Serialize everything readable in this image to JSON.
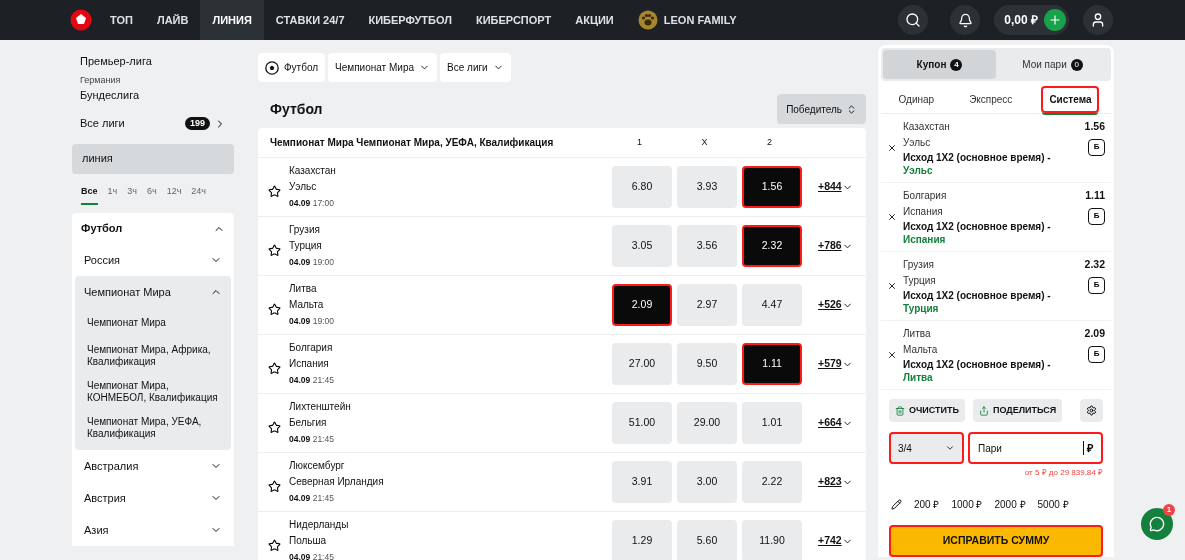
{
  "nav": {
    "items": [
      {
        "label": "ТОП",
        "selected": false
      },
      {
        "label": "ЛАЙВ",
        "selected": false
      },
      {
        "label": "ЛИНИЯ",
        "selected": true
      },
      {
        "label": "СТАВКИ 24/7",
        "selected": false
      },
      {
        "label": "КИБЕРФУТБОЛ",
        "selected": false
      },
      {
        "label": "КИБЕРСПОРТ",
        "selected": false
      },
      {
        "label": "АКЦИИ",
        "selected": false
      },
      {
        "label": "LEON FAMILY",
        "selected": false
      }
    ],
    "balance": "0,00 ₽"
  },
  "sidebar": {
    "top_leagues": [
      {
        "league": "Премьер-лига"
      },
      {
        "country": "Германия",
        "league": "Бундеслига"
      }
    ],
    "all_leagues": {
      "label": "Все лиги",
      "count": "199"
    },
    "section": "линия",
    "time_filters": [
      {
        "label": "Все",
        "selected": true
      },
      {
        "label": "1ч",
        "selected": false
      },
      {
        "label": "3ч",
        "selected": false
      },
      {
        "label": "6ч",
        "selected": false
      },
      {
        "label": "12ч",
        "selected": false
      },
      {
        "label": "24ч",
        "selected": false
      }
    ],
    "sport": {
      "label": "Футбол",
      "expanded": true,
      "children": [
        {
          "label": "Россия",
          "expanded": false
        },
        {
          "label": "Чемпионат Мира",
          "expanded": true,
          "children": [
            {
              "label": "Чемпионат Мира"
            },
            {
              "label": "Чемпионат Мира, Африка, Квалификация"
            },
            {
              "label": "Чемпионат Мира, КОНМЕБОЛ, Квалификация"
            },
            {
              "label": "Чемпионат Мира, УЕФА, Квалификация"
            }
          ]
        },
        {
          "label": "Австралия",
          "expanded": false
        },
        {
          "label": "Австрия",
          "expanded": false
        },
        {
          "label": "Азия",
          "expanded": false
        }
      ]
    }
  },
  "filters": [
    {
      "label": "Футбол",
      "kind": "sport"
    },
    {
      "label": "Чемпионат Мира",
      "kind": "dropdown"
    },
    {
      "label": "Все лиги",
      "kind": "dropdown"
    }
  ],
  "main": {
    "title": "Футбол",
    "sort": "Победитель",
    "league": "Чемпионат Мира Чемпионат Мира, УЕФА, Квалификация",
    "columns": [
      "1",
      "X",
      "2"
    ],
    "events": [
      {
        "home": "Казахстан",
        "away": "Уэльс",
        "date": "04.09",
        "time": "17:00",
        "more": "+844",
        "odds": [
          {
            "value": "6.80",
            "selected": false
          },
          {
            "value": "3.93",
            "selected": false
          },
          {
            "value": "1.56",
            "selected": true
          }
        ]
      },
      {
        "home": "Грузия",
        "away": "Турция",
        "date": "04.09",
        "time": "19:00",
        "more": "+786",
        "odds": [
          {
            "value": "3.05",
            "selected": false
          },
          {
            "value": "3.56",
            "selected": false
          },
          {
            "value": "2.32",
            "selected": true
          }
        ]
      },
      {
        "home": "Литва",
        "away": "Мальта",
        "date": "04.09",
        "time": "19:00",
        "more": "+526",
        "odds": [
          {
            "value": "2.09",
            "selected": true
          },
          {
            "value": "2.97",
            "selected": false
          },
          {
            "value": "4.47",
            "selected": false
          }
        ]
      },
      {
        "home": "Болгария",
        "away": "Испания",
        "date": "04.09",
        "time": "21:45",
        "more": "+579",
        "odds": [
          {
            "value": "27.00",
            "selected": false
          },
          {
            "value": "9.50",
            "selected": false
          },
          {
            "value": "1.11",
            "selected": true
          }
        ]
      },
      {
        "home": "Лихтенштейн",
        "away": "Бельгия",
        "date": "04.09",
        "time": "21:45",
        "more": "+664",
        "odds": [
          {
            "value": "51.00",
            "selected": false
          },
          {
            "value": "29.00",
            "selected": false
          },
          {
            "value": "1.01",
            "selected": false
          }
        ]
      },
      {
        "home": "Люксембург",
        "away": "Северная Ирландия",
        "date": "04.09",
        "time": "21:45",
        "more": "+823",
        "odds": [
          {
            "value": "3.91",
            "selected": false
          },
          {
            "value": "3.00",
            "selected": false
          },
          {
            "value": "2.22",
            "selected": false
          }
        ]
      },
      {
        "home": "Нидерланды",
        "away": "Польша",
        "date": "04.09",
        "time": "21:45",
        "more": "+742",
        "odds": [
          {
            "value": "1.29",
            "selected": false
          },
          {
            "value": "5.60",
            "selected": false
          },
          {
            "value": "11.90",
            "selected": false
          }
        ]
      }
    ]
  },
  "coupon": {
    "tabs": [
      {
        "label": "Купон",
        "count": "4",
        "selected": true
      },
      {
        "label": "Мои пари",
        "count": "0",
        "selected": false
      }
    ],
    "bet_types": [
      {
        "label": "Одинар",
        "selected": false
      },
      {
        "label": "Экспресс",
        "selected": false
      },
      {
        "label": "Система",
        "selected": true
      }
    ],
    "bets": [
      {
        "home": "Казахстан",
        "away": "Уэльс",
        "market": "Исход 1X2 (основное время) -",
        "pick": "Уэльс",
        "odds": "1.56",
        "badge": "Б"
      },
      {
        "home": "Болгария",
        "away": "Испания",
        "market": "Исход 1X2 (основное время) -",
        "pick": "Испания",
        "odds": "1.11",
        "badge": "Б"
      },
      {
        "home": "Грузия",
        "away": "Турция",
        "market": "Исход 1X2 (основное время) -",
        "pick": "Турция",
        "odds": "2.32",
        "badge": "Б"
      },
      {
        "home": "Литва",
        "away": "Мальта",
        "market": "Исход 1X2 (основное время) -",
        "pick": "Литва",
        "odds": "2.09",
        "badge": "Б"
      }
    ],
    "clear": "ОЧИСТИТЬ",
    "share": "ПОДЕЛИТЬСЯ",
    "system": "3/4",
    "stake_placeholder": "Пари",
    "currency": "₽",
    "limits": "от 5 ₽ до 29 839,84 ₽",
    "quick_stakes": [
      "200 ₽",
      "1000 ₽",
      "2000 ₽",
      "5000 ₽"
    ],
    "submit": "ИСПРАВИТЬ СУММУ"
  },
  "chat": {
    "badge": "1"
  }
}
